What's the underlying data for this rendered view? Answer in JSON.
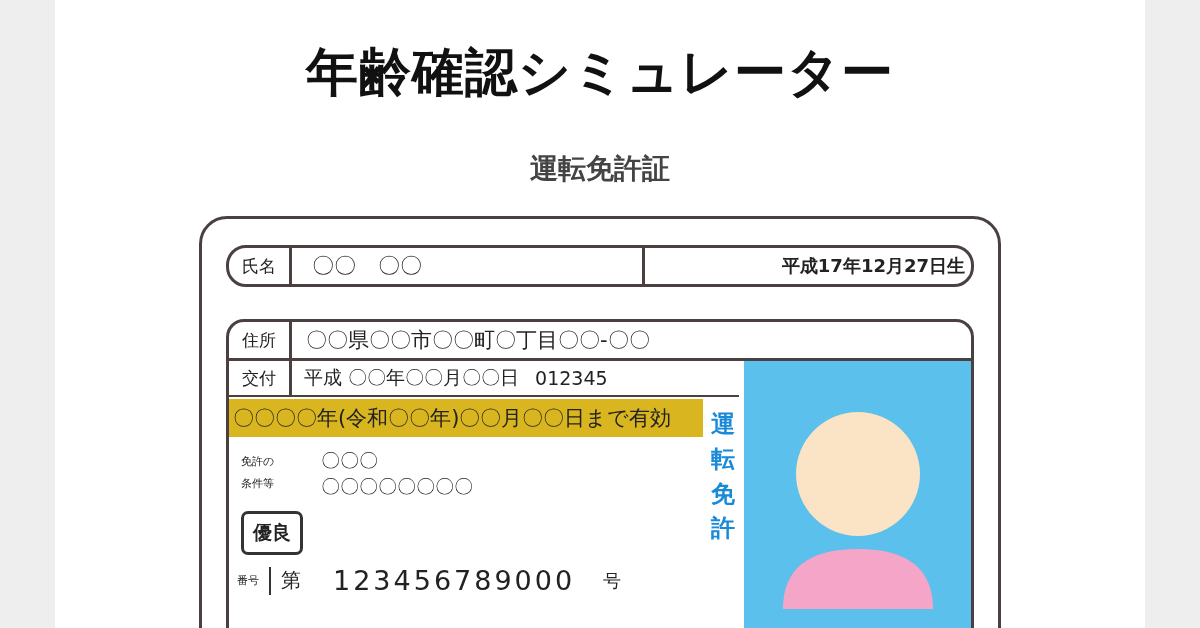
{
  "page": {
    "title": "年齢確認シミュレーター",
    "subtitle": "運転免許証"
  },
  "license": {
    "name_label": "氏名",
    "name": "〇〇　〇〇",
    "birth_date": "平成17年12月27日生",
    "address_label": "住所",
    "address": "〇〇県〇〇市〇〇町〇丁目〇〇-〇〇",
    "issue_label": "交付",
    "issue_date": "平成 〇〇年〇〇月〇〇日",
    "issue_number": "012345",
    "expiry": "〇〇〇〇年(令和〇〇年)〇〇月〇〇日まで有効",
    "vertical_title": "運転免許",
    "conditions_label": [
      "免許の",
      "条件等"
    ],
    "conditions": [
      "〇〇〇",
      "〇〇〇〇〇〇〇〇"
    ],
    "badge": "優良",
    "number_label": "番号",
    "number_prefix": "第",
    "number": "123456789000",
    "number_suffix": "号"
  }
}
